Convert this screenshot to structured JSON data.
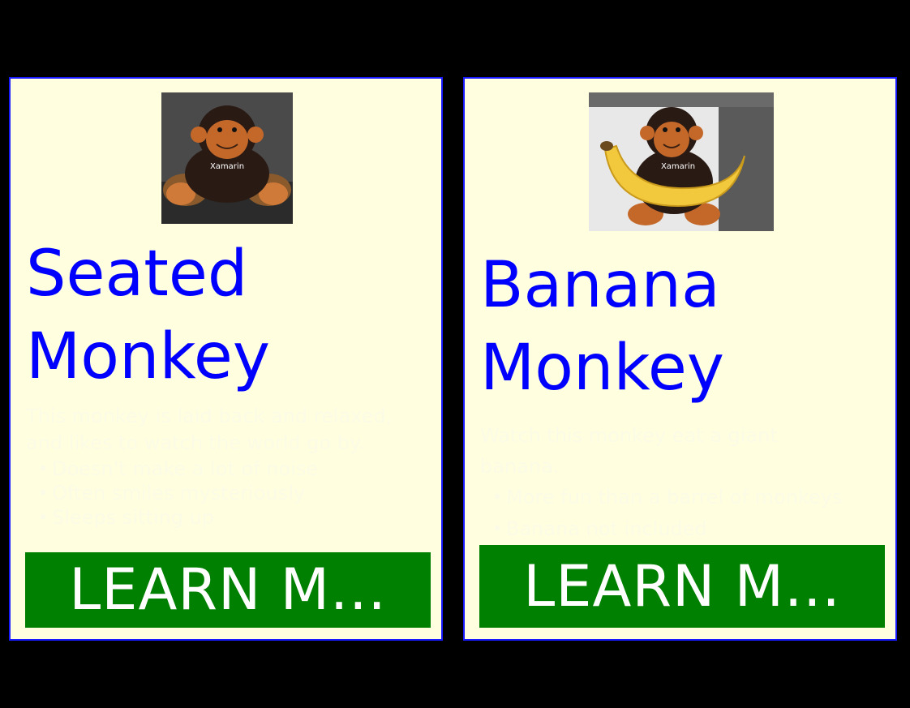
{
  "cards": [
    {
      "title": "Seated\nMonkey",
      "description": "This monkey is laid back and relaxed, and likes to watch the world go by.",
      "bullets": [
        "Doesn't make a lot of noise",
        "Often smiles mysteriously",
        "Sleeps sitting up"
      ],
      "button_label": "LEARN M...",
      "image_shirt_text": "Xamarin"
    },
    {
      "title": "Banana\nMonkey",
      "description": "Watch this monkey eat a giant banana.",
      "bullets": [
        "More fun than a barrel of monkeys",
        "Banana not included"
      ],
      "button_label": "LEARN M...",
      "image_shirt_text": "Xamarin"
    }
  ],
  "colors": {
    "background": "#000000",
    "card_background": "#ffffe0",
    "card_border": "#1a1aff",
    "title": "#0000ff",
    "button_background": "#008000",
    "button_text": "#ffffff"
  }
}
